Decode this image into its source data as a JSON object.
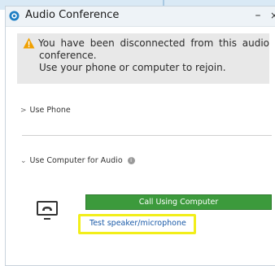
{
  "window": {
    "title": "Audio Conference",
    "minimize_glyph": "–",
    "close_glyph": "×"
  },
  "warning": {
    "line1": "You have been disconnected from this audio",
    "line2": "conference.",
    "line3": "Use your phone or computer to rejoin.",
    "icon": "warning-icon",
    "icon_color": "#f0a000"
  },
  "sections": {
    "use_phone": "Use Phone",
    "use_computer": "Use Computer for Audio",
    "chevron_collapsed": ">",
    "chevron_expanded": "⌄",
    "info_glyph": "i"
  },
  "computer_audio": {
    "call_button": "Call Using Computer",
    "test_link": "Test speaker/microphone"
  },
  "colors": {
    "call_button": "#3c9a3c",
    "link": "#1a5aa8",
    "highlight": "#f2ee1a"
  }
}
